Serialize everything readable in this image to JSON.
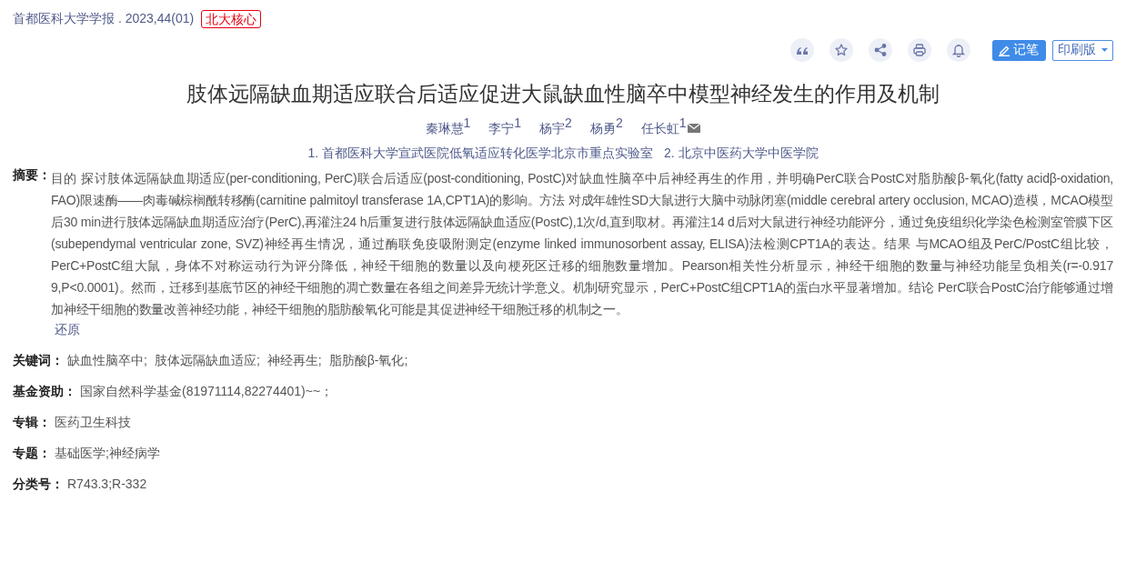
{
  "source": {
    "journal": "首都医科大学学报 . 2023,44(01)",
    "badge": "北大核心"
  },
  "toolbar": {
    "icon_buttons": [
      {
        "kind": "quote"
      },
      {
        "kind": "star"
      },
      {
        "kind": "share"
      },
      {
        "kind": "print"
      },
      {
        "kind": "bell"
      }
    ],
    "note_button": "记笔",
    "print_menu": "印刷版"
  },
  "title": "肢体远隔缺血期适应联合后适应促进大鼠缺血性脑卒中模型神经发生的作用及机制",
  "authors": [
    {
      "name": "秦琳慧$^{1}$",
      "email": false
    },
    {
      "name": "李宁$^{1}$",
      "email": false
    },
    {
      "name": "杨宇$^{2}$",
      "email": false
    },
    {
      "name": "杨勇$^{2}$",
      "email": false
    },
    {
      "name": "任长虹$^{1}$",
      "email": true
    }
  ],
  "affiliations": [
    "1. 首都医科大学宣武医院低氧适应转化医学北京市重点实验室",
    "2. 北京中医药大学中医学院"
  ],
  "abstract": {
    "label": "摘要：",
    "text": "目的 探讨肢体远隔缺血期适应(per-conditioning, PerC)联合后适应(post-conditioning, PostC)对缺血性脑卒中后神经再生的作用，并明确PerC联合PostC对脂肪酸β-氧化(fatty acidβ-oxidation, FAO)限速酶——肉毒碱棕榈酰转移酶(carnitine palmitoyl transferase 1A,CPT1A)的影响。方法 对成年雄性SD大鼠进行大脑中动脉闭塞(middle cerebral artery occlusion, MCAO)造模，MCAO模型后30 min进行肢体远隔缺血期适应治疗(PerC),再灌注24 h后重复进行肢体远隔缺血适应(PostC),1次/d,直到取材。再灌注14 d后对大鼠进行神经功能评分，通过免疫组织化学染色检测室管膜下区(subependymal ventricular zone, SVZ)神经再生情况，通过酶联免疫吸附测定(enzyme linked immunosorbent assay, ELISA)法检测CPT1A的表达。结果 与MCAO组及PerC/PostC组比较，PerC+PostC组大鼠，身体不对称运动行为评分降低，神经干细胞的数量以及向梗死区迁移的细胞数量增加。Pearson相关性分析显示，神经干细胞的数量与神经功能呈负相关(r=-0.917 9,P<0.0001)。然而，迁移到基底节区的神经干细胞的凋亡数量在各组之间差异无统计学意义。机制研究显示，PerC+PostC组CPT1A的蛋白水平显著增加。结论 PerC联合PostC治疗能够通过增加神经干细胞的数量改善神经功能，神经干细胞的脂肪酸氧化可能是其促进神经干细胞迁移的机制之一。",
    "restore": "还原"
  },
  "fields": [
    {
      "label": "关键词：",
      "links": [
        "缺血性脑卒中;",
        "肢体远隔缺血适应;",
        "神经再生;",
        "脂肪酸β-氧化;"
      ]
    },
    {
      "label": "基金资助：",
      "links": [
        "国家自然科学基金(81971114,82274401)~~；"
      ]
    },
    {
      "label": "专辑：",
      "value": "医药卫生科技"
    },
    {
      "label": "专题：",
      "value": "基础医学;神经病学"
    },
    {
      "label": "分类号：",
      "value": "R743.3;R-332"
    }
  ]
}
